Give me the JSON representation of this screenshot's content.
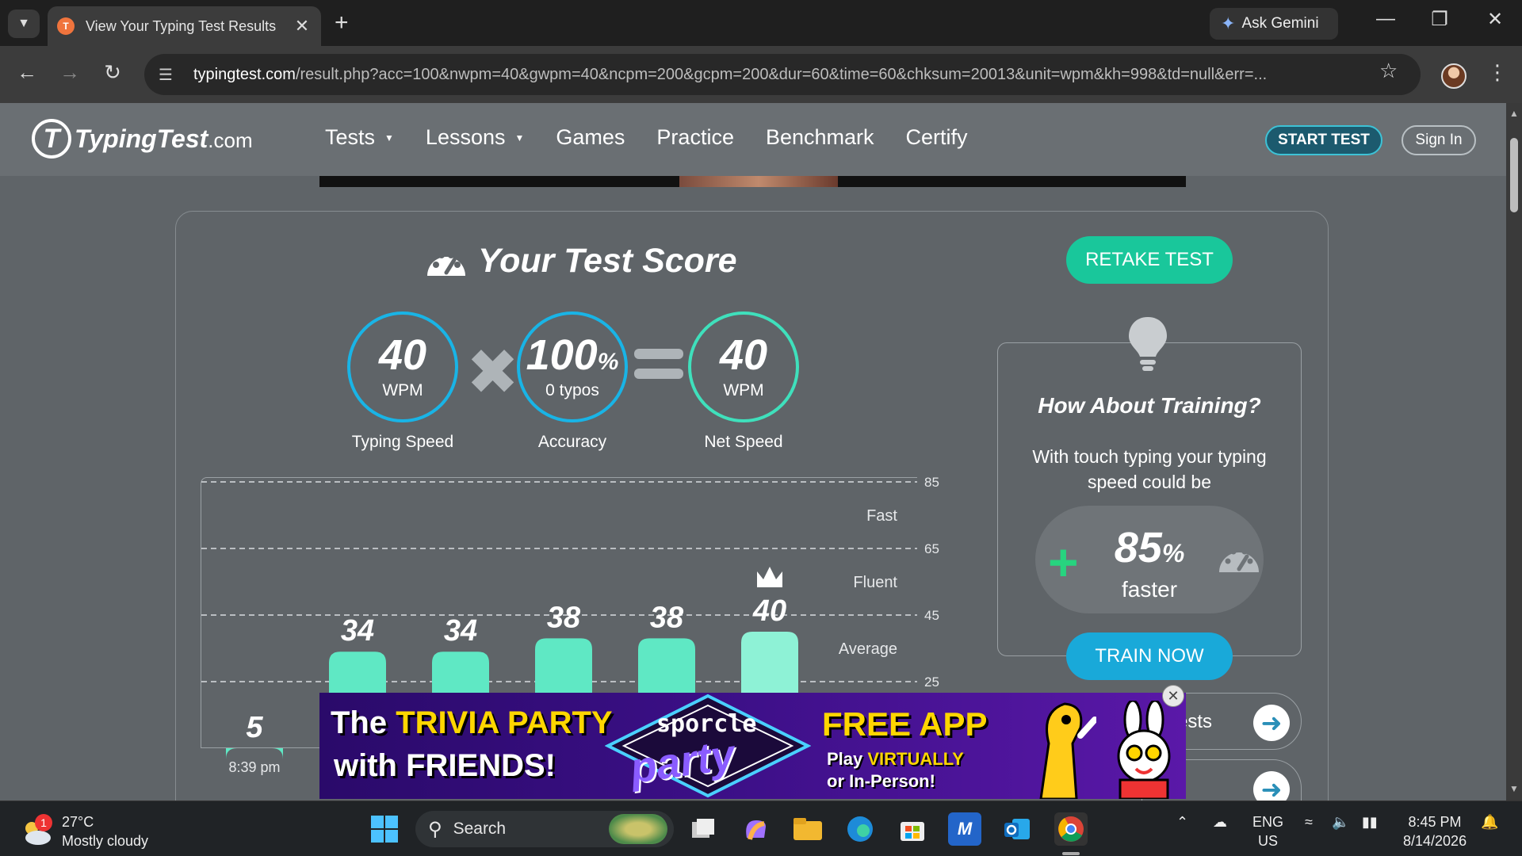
{
  "browser": {
    "tab_title": "View Your Typing Test Results",
    "tab_close": "✕",
    "new_tab": "+",
    "gemini_label": "Ask Gemini",
    "url_host": "typingtest.com",
    "url_rest": "/result.php?acc=100&nwpm=40&gwpm=40&ncpm=200&gcpm=200&dur=60&time=60&chksum=20013&unit=wpm&kh=998&td=null&err=..."
  },
  "site": {
    "logo_word": "TypingTest",
    "logo_domain": ".com",
    "nav": [
      {
        "label": "Tests",
        "dropdown": true
      },
      {
        "label": "Lessons",
        "dropdown": true
      },
      {
        "label": "Games",
        "dropdown": false
      },
      {
        "label": "Practice",
        "dropdown": false
      },
      {
        "label": "Benchmark",
        "dropdown": false
      },
      {
        "label": "Certify",
        "dropdown": false
      }
    ],
    "start_test": "START TEST",
    "sign_in": "Sign In"
  },
  "score": {
    "title": "Your Test Score",
    "retake": "RETAKE TEST",
    "typing_speed": {
      "value": "40",
      "unit": "WPM",
      "label": "Typing Speed"
    },
    "accuracy": {
      "value": "100",
      "pct": "%",
      "typos": "0 typos",
      "label": "Accuracy"
    },
    "net_speed": {
      "value": "40",
      "unit": "WPM",
      "label": "Net Speed"
    }
  },
  "chart_data": {
    "type": "bar",
    "categories": [
      "8:39 pm",
      "",
      "",
      "",
      "",
      ""
    ],
    "values": [
      5,
      34,
      34,
      38,
      38,
      40
    ],
    "best_index": 5,
    "ylim": [
      5,
      85
    ],
    "y_ticks": [
      25,
      45,
      65,
      85
    ],
    "bands": [
      {
        "label": "Average",
        "value": 35
      },
      {
        "label": "Fluent",
        "value": 55
      },
      {
        "label": "Fast",
        "value": 75
      }
    ],
    "bar_color": "#5fe8c4",
    "best_bar_color": "#8ef2d6"
  },
  "training": {
    "title": "How About Training?",
    "text": "With touch typing your typing speed could be",
    "plus": "+",
    "percent": "85",
    "percent_sign": "%",
    "faster": "faster",
    "button": "TRAIN NOW",
    "side_pill_label": "ests"
  },
  "ad": {
    "line1_a": "The ",
    "line1_b": "TRIVIA PARTY",
    "line2": "with FRIENDS!",
    "brand1": "sporcle",
    "brand2": "party",
    "free": "FREE APP",
    "play_a": "Play ",
    "play_b": "VIRTUALLY",
    "play_c": "or In-Person!",
    "close": "✕"
  },
  "taskbar": {
    "temp": "27°C",
    "condition": "Mostly cloudy",
    "weather_badge": "1",
    "search": "Search",
    "lang1": "ENG",
    "lang2": "US",
    "time": "8:45 PM",
    "date": "8/14/2026"
  }
}
